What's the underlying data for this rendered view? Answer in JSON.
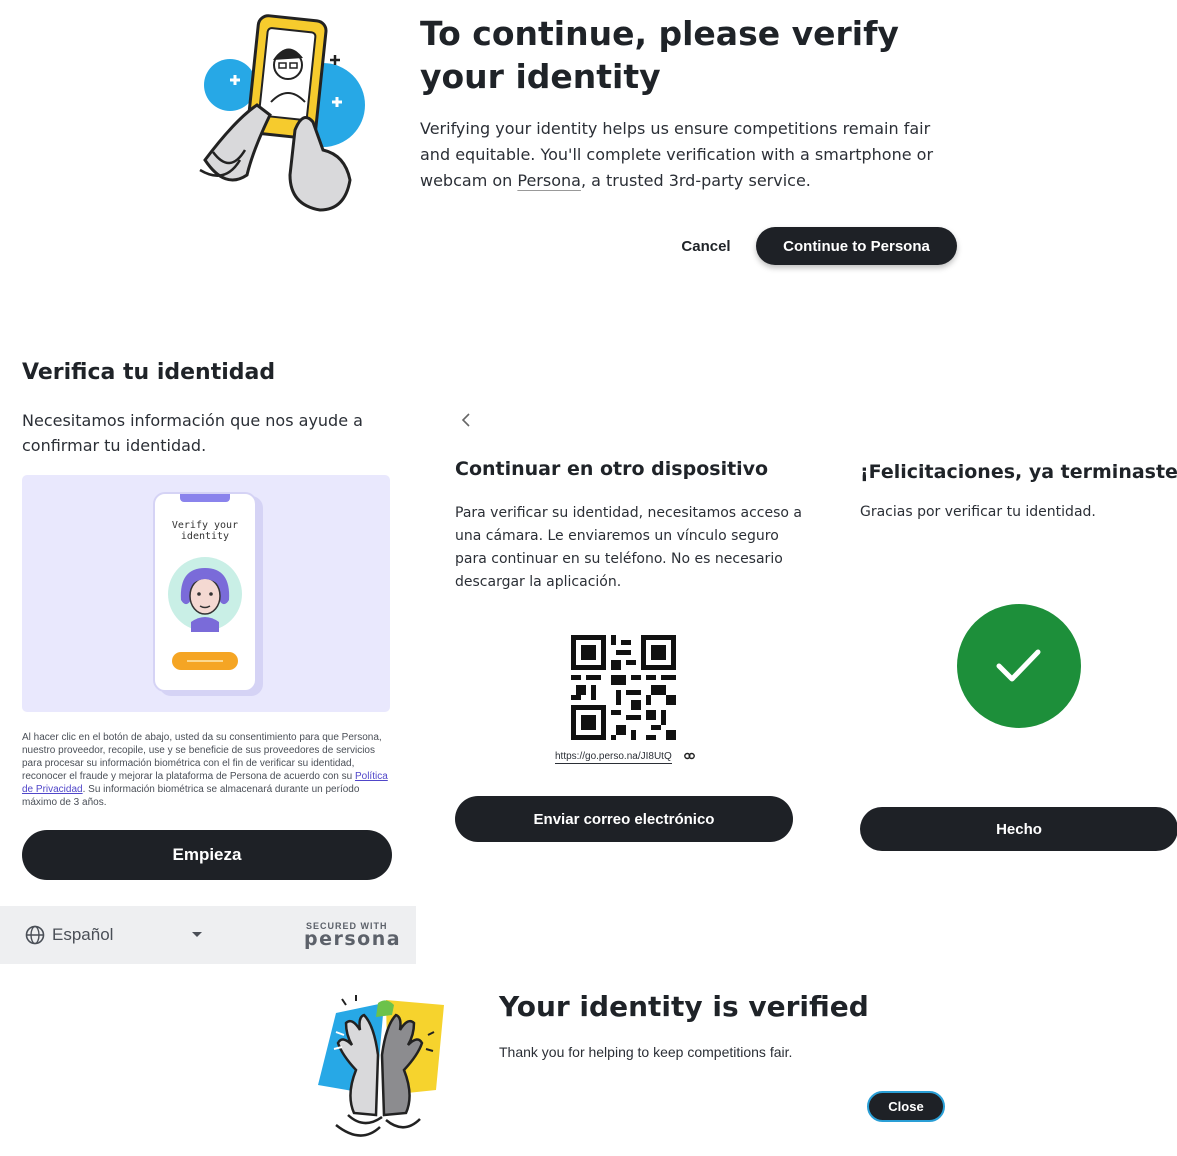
{
  "top": {
    "title": "To continue, please verify your identity",
    "description_before": "Verifying your identity helps us ensure competitions remain fair and equitable. You'll complete verification with a smartphone or webcam on ",
    "description_link": "Persona",
    "description_after": ", a trusted 3rd-party service.",
    "cancel_label": "Cancel",
    "continue_label": "Continue to Persona"
  },
  "verify_panel": {
    "title": "Verifica tu identidad",
    "subtitle": "Necesitamos información que nos ayude a confirmar tu identidad.",
    "phone_text_line1": "Verify your",
    "phone_text_line2": "identity",
    "consent_before": "Al hacer clic en el botón de abajo, usted da su consentimiento para que Persona, nuestro proveedor, recopile, use y se beneficie de sus proveedores de servicios para procesar su información biométrica con el fin de verificar su identidad, reconocer el fraude y mejorar la plataforma de Persona de acuerdo con su ",
    "consent_link": "Política de Privacidad",
    "consent_after": ". Su información biométrica se almacenará durante un período máximo de 3 años.",
    "start_label": "Empieza",
    "language": "Español",
    "secured_with": "SECURED WITH",
    "brand": "persona"
  },
  "other_device": {
    "title": "Continuar en otro dispositivo",
    "description": "Para verificar su identidad, necesitamos acceso a una cámara. Le enviaremos un vínculo seguro para continuar en su teléfono. No es necesario descargar la aplicación.",
    "qr_link": "https://go.perso.na/JI8UtQ",
    "email_label": "Enviar correo electrónico"
  },
  "done_panel": {
    "title": "¡Felicitaciones, ya terminaste!",
    "description": "Gracias por verificar tu identidad.",
    "done_label": "Hecho",
    "status_color": "#1d8f3a"
  },
  "verified": {
    "title": "Your identity is verified",
    "description": "Thank you for helping to keep competitions fair.",
    "close_label": "Close"
  },
  "icons": {
    "back": "chevron-left-icon",
    "globe": "globe-icon",
    "dropdown": "caret-down-icon",
    "link": "link-icon",
    "check": "checkmark-icon"
  }
}
